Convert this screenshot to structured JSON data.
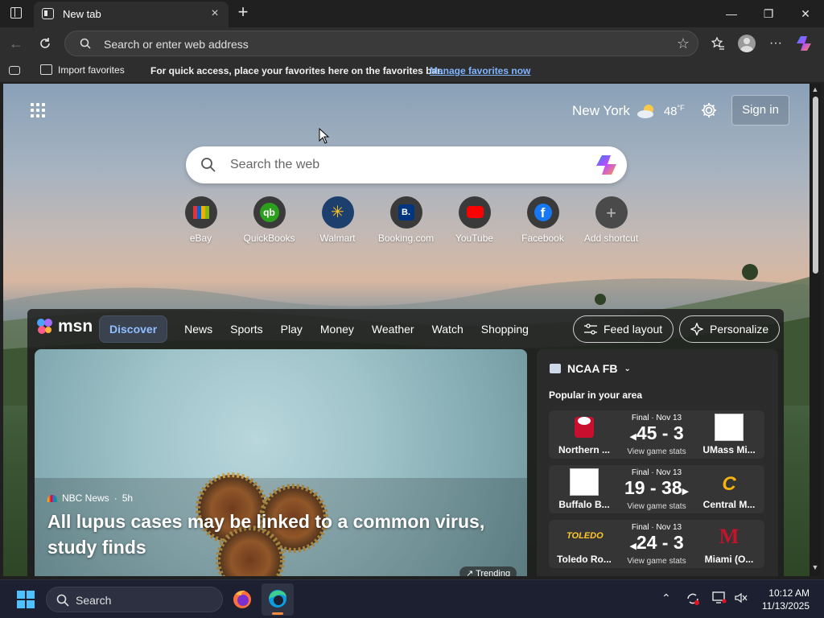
{
  "browser": {
    "tab_title": "New tab",
    "tab_close": "×",
    "new_tab": "+",
    "minimize": "—",
    "maximize": "❐",
    "close": "✕",
    "address_placeholder": "Search or enter web address"
  },
  "favorites_bar": {
    "import_label": "Import favorites",
    "message": "For quick access, place your favorites here on the favorites bar.",
    "manage_link": "Manage favorites now"
  },
  "newtab": {
    "weather": {
      "city": "New York",
      "temperature": "48",
      "unit": "°F"
    },
    "sign_in": "Sign in",
    "search_placeholder": "Search the web",
    "shortcuts": [
      {
        "label": "eBay",
        "color": "#2a2a2a"
      },
      {
        "label": "QuickBooks",
        "color": "#2ca01c"
      },
      {
        "label": "Walmart",
        "color": "#0071ce"
      },
      {
        "label": "Booking.com",
        "color": "#003580"
      },
      {
        "label": "YouTube",
        "color": "#ff0000"
      },
      {
        "label": "Facebook",
        "color": "#1877f2"
      },
      {
        "label": "Add shortcut",
        "color": "#5a5a5a"
      }
    ]
  },
  "msn": {
    "logo": "msn",
    "nav": [
      "Discover",
      "News",
      "Sports",
      "Play",
      "Money",
      "Weather",
      "Watch",
      "Shopping"
    ],
    "feed_layout": "Feed layout",
    "personalize": "Personalize",
    "hero": {
      "source": "NBC News",
      "age": "5h",
      "title": "All lupus cases may be linked to a common virus, study finds",
      "badge": "Trending"
    },
    "sports": {
      "league": "NCAA FB",
      "subtitle": "Popular in your area",
      "games": [
        {
          "status": "Final · Nov 13",
          "score": "45 - 3",
          "winner": "left",
          "link": "View game stats",
          "team_left": "Northern ...",
          "team_right": "UMass Mi..."
        },
        {
          "status": "Final · Nov 13",
          "score": "19 - 38",
          "winner": "right",
          "link": "View game stats",
          "team_left": "Buffalo B...",
          "team_right": "Central M..."
        },
        {
          "status": "Final · Nov 13",
          "score": "24 - 3",
          "winner": "left",
          "link": "View game stats",
          "team_left": "Toledo Ro...",
          "team_right": "Miami (O..."
        }
      ]
    }
  },
  "taskbar": {
    "search_label": "Search",
    "time": "10:12 AM",
    "date": "11/13/2025"
  },
  "colors": {
    "accent_link": "#7fb5ff",
    "taskbar_bg": "#1c2030",
    "edge_indicator": "#f08a3c"
  }
}
